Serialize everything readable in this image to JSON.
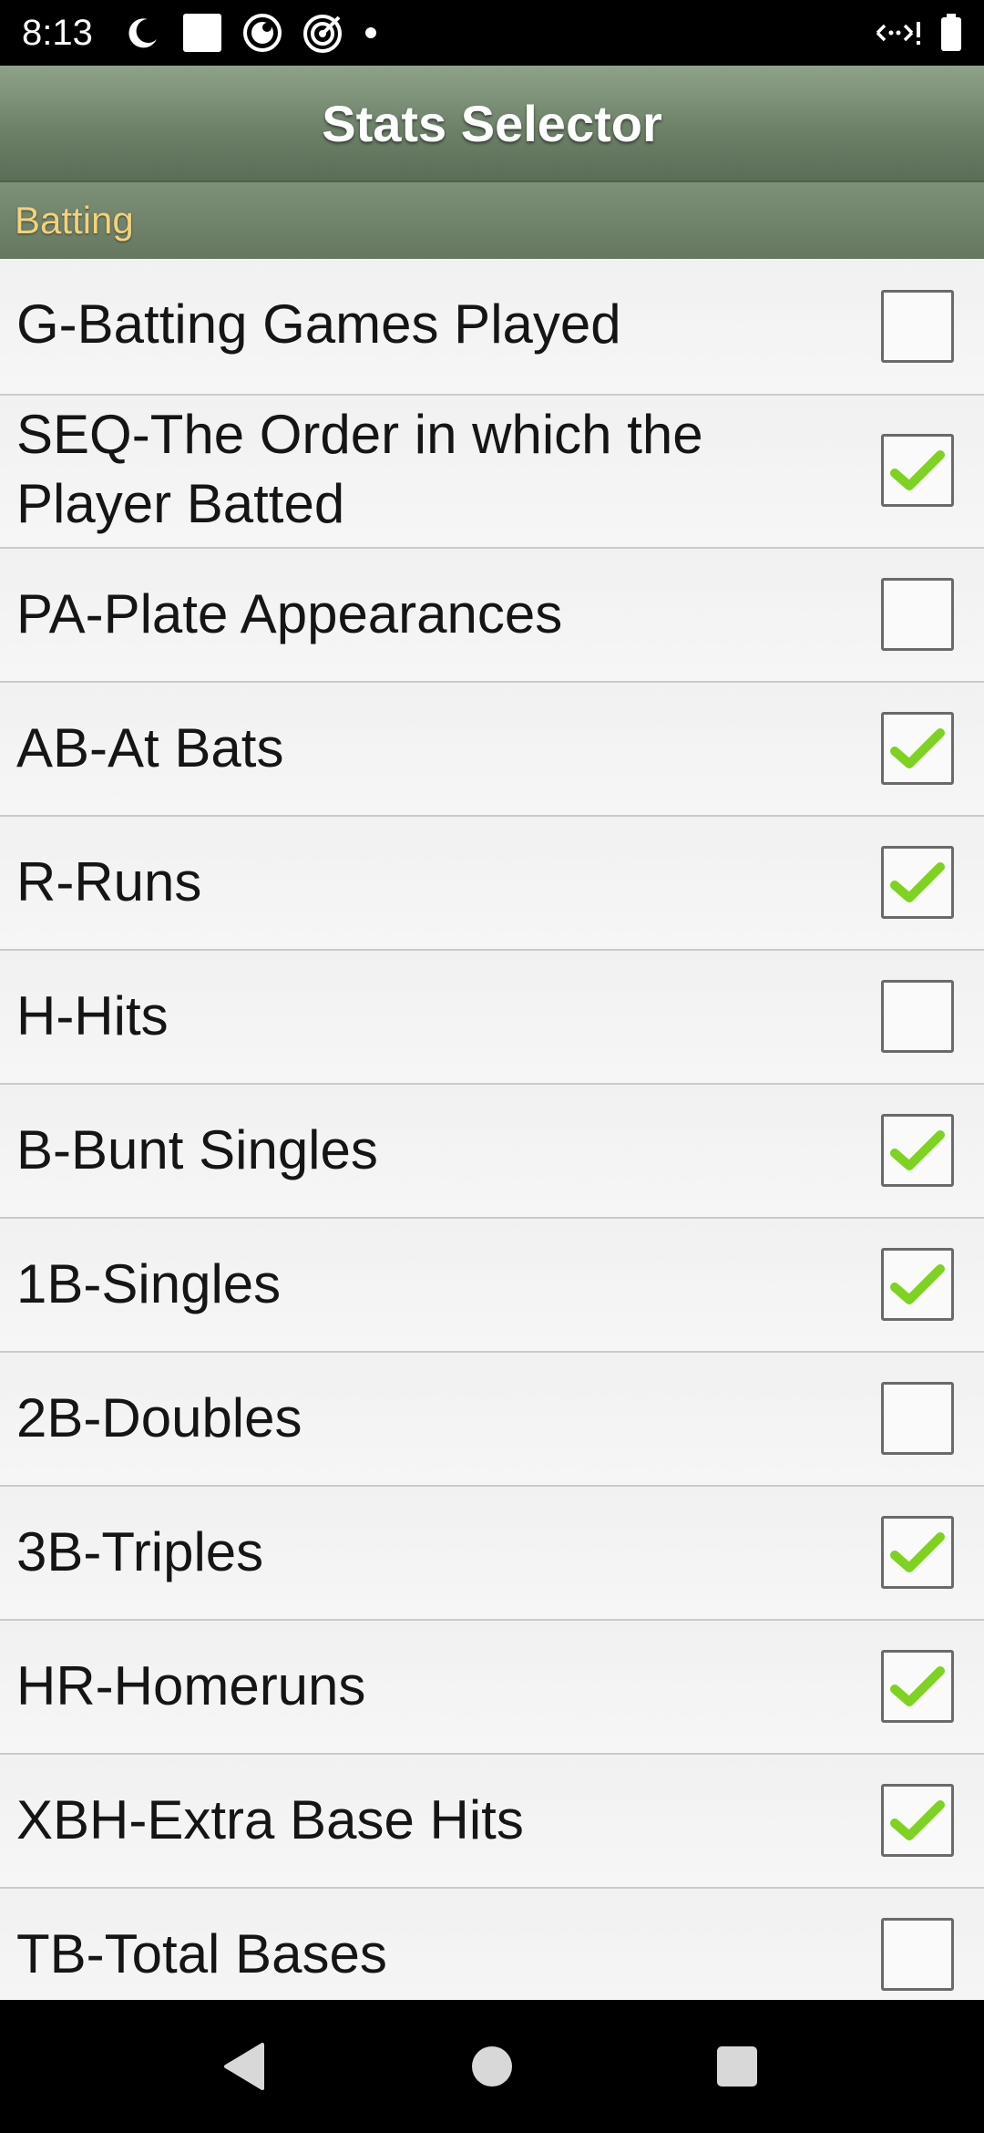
{
  "status_bar": {
    "time": "8:13",
    "left_icons": [
      "do-not-disturb-icon",
      "square-notification-icon",
      "record-icon",
      "target-icon",
      "dot-icon"
    ],
    "right_icons": [
      "data-transfer-icon",
      "battery-icon"
    ]
  },
  "app_bar": {
    "title": "Stats Selector"
  },
  "section": {
    "label": "Batting"
  },
  "stats": [
    {
      "label": "G-Batting Games Played",
      "checked": false
    },
    {
      "label": "SEQ-The Order in which the Player Batted",
      "checked": true
    },
    {
      "label": "PA-Plate Appearances",
      "checked": false
    },
    {
      "label": "AB-At Bats",
      "checked": true
    },
    {
      "label": "R-Runs",
      "checked": true
    },
    {
      "label": "H-Hits",
      "checked": false
    },
    {
      "label": "B-Bunt Singles",
      "checked": true
    },
    {
      "label": "1B-Singles",
      "checked": true
    },
    {
      "label": "2B-Doubles",
      "checked": false
    },
    {
      "label": "3B-Triples",
      "checked": true
    },
    {
      "label": "HR-Homeruns",
      "checked": true
    },
    {
      "label": "XBH-Extra Base Hits",
      "checked": true
    },
    {
      "label": "TB-Total Bases",
      "checked": false
    }
  ],
  "nav_bar": {
    "buttons": [
      "back-icon",
      "home-icon",
      "recents-icon"
    ]
  },
  "colors": {
    "app_bar": "#6d8169",
    "section_label": "#f3d27a",
    "check": "#7ed321"
  }
}
